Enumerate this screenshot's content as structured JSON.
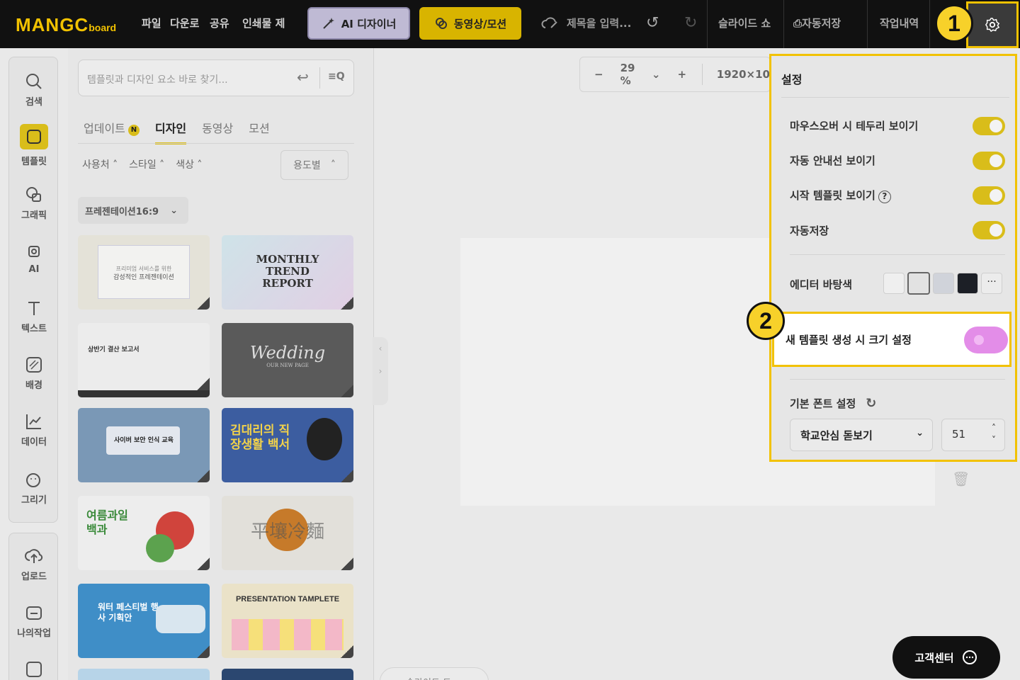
{
  "topbar": {
    "logo_main": "MANGC",
    "logo_sub": "board",
    "menu": [
      "파일",
      "다운로",
      "공유",
      "인쇄물 제"
    ],
    "ai_designer": "AI 디자이너",
    "video_motion": "동영상/모션",
    "title_placeholder": "제목을 입력...",
    "slideshow": "슬라이드 쇼",
    "autosave": "자동저장",
    "history": "작업내역"
  },
  "steps": {
    "one": "1",
    "two": "2"
  },
  "rail": {
    "items": [
      "검색",
      "템플릿",
      "그래픽",
      "AI",
      "텍스트",
      "배경",
      "데이터",
      "그리기"
    ],
    "bottom": [
      "업로드",
      "나의작업"
    ]
  },
  "panel": {
    "search_placeholder": "템플릿과 디자인 요소 바로 찾기...",
    "tabs": [
      "업데이트",
      "디자인",
      "동영상",
      "모션"
    ],
    "badge": "N",
    "filters": [
      "사용처",
      "스타일",
      "색상"
    ],
    "use_button": "용도별",
    "category": "프레젠테이션16:9",
    "thumbs": [
      {
        "title": "감성적인 프레젠테이션",
        "sub": "프리미엄 서비스를 위한"
      },
      {
        "title": "MONTHLY TREND REPORT",
        "sub": ""
      },
      {
        "title": "상반기 결산 보고서",
        "sub": ""
      },
      {
        "title": "Wedding",
        "sub": "OUR NEW PAGE"
      },
      {
        "title": "사이버 보안 인식 교육",
        "sub": ""
      },
      {
        "title": "김대리의 직장생활 백서",
        "sub": ""
      },
      {
        "title": "여름과일 백과",
        "sub": ""
      },
      {
        "title": "平壤冷麵",
        "sub": ""
      },
      {
        "title": "워터 페스티벌 행사 기획안",
        "sub": ""
      },
      {
        "title": "PRESENTATION TAMPLETE",
        "sub": ""
      }
    ]
  },
  "canvas": {
    "zoom_value": "29 %",
    "size": "1920×10",
    "slide_tab": "ㅁ   슬라이드 도"
  },
  "settings": {
    "title": "설정",
    "rows": [
      {
        "label": "마우스오버 시 테두리 보이기",
        "on": true
      },
      {
        "label": "자동 안내선 보이기",
        "on": true
      },
      {
        "label": "시작 템플릿 보이기",
        "on": true
      },
      {
        "label": "자동저장",
        "on": true
      }
    ],
    "editor_bg_label": "에디터 바탕색",
    "swatch_colors": [
      "#efefef",
      "#e2e2e2",
      "#d0d3da",
      "#1c1f26"
    ],
    "highlight_label": "새 템플릿 생성 시 크기 설정",
    "highlight_on": false,
    "font_label": "기본 폰트 설정",
    "font_value": "학교안심 돋보기",
    "font_size": "51"
  },
  "support": "고객센터",
  "colors": {
    "accent": "#f2c200",
    "toggle_on": "#d9bd1a",
    "toggle_off_highlight": "#e38de8"
  }
}
